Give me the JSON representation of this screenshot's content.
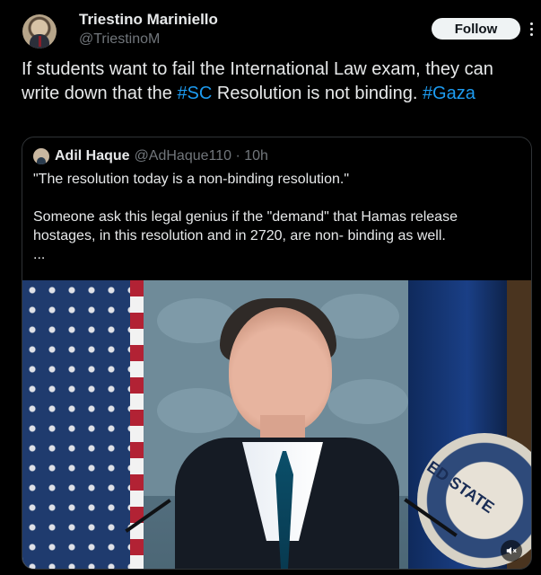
{
  "author": {
    "name": "Triestino Mariniello",
    "handle": "@TriestinoM",
    "follow_label": "Follow"
  },
  "tweet": {
    "text_1": "If students want to fail the International Law exam, they can write down that the ",
    "hashtag_1": "#SC",
    "text_2": " Resolution is not binding. ",
    "hashtag_2": "#Gaza"
  },
  "quote": {
    "name": "Adil Haque",
    "handle_time": "@AdHaque110 · 10h",
    "line_1": "\"The resolution today is a non-binding resolution.\"",
    "line_2": "Someone ask this legal genius if the \"demand\" that Hamas release hostages, in this resolution and in 2720, are non- binding as well.",
    "line_3": "..."
  },
  "media": {
    "emblem_text": "ED STATE",
    "mute_icon": "mute-icon"
  },
  "colors": {
    "background": "#000000",
    "text": "#e7e9ea",
    "muted": "#71767b",
    "link": "#1d9bf0",
    "border": "#2f3336"
  }
}
